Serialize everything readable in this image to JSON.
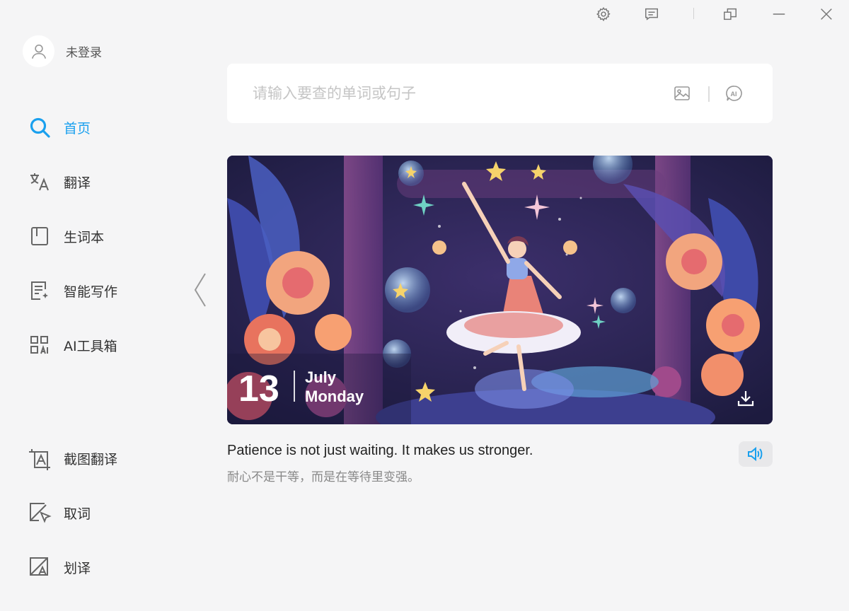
{
  "titlebar": {
    "icons": [
      "gear-icon",
      "feedback-icon",
      "restore-window-icon",
      "minimize-icon",
      "close-icon"
    ]
  },
  "user": {
    "name": "未登录",
    "icon": "user-icon"
  },
  "nav": {
    "top": [
      {
        "label": "首页",
        "icon": "search-icon",
        "active": true
      },
      {
        "label": "翻译",
        "icon": "translate-icon"
      },
      {
        "label": "生词本",
        "icon": "notebook-icon"
      },
      {
        "label": "智能写作",
        "icon": "writing-icon"
      },
      {
        "label": "AI工具箱",
        "icon": "ai-toolbox-icon"
      }
    ],
    "bottom": [
      {
        "label": "截图翻译",
        "icon": "screenshot-translate-icon"
      },
      {
        "label": "取词",
        "icon": "pick-word-icon"
      },
      {
        "label": "划译",
        "icon": "select-translate-icon"
      }
    ]
  },
  "search": {
    "placeholder": "请输入要查的单词或句子",
    "value": ""
  },
  "banner": {
    "day": "13",
    "month": "July",
    "weekday": "Monday"
  },
  "quote": {
    "en": "Patience is not just waiting. It makes us stronger.",
    "cn": "耐心不是干等，而是在等待里变强。"
  },
  "colors": {
    "accent": "#1aa0ee",
    "background": "#f5f5f6"
  }
}
